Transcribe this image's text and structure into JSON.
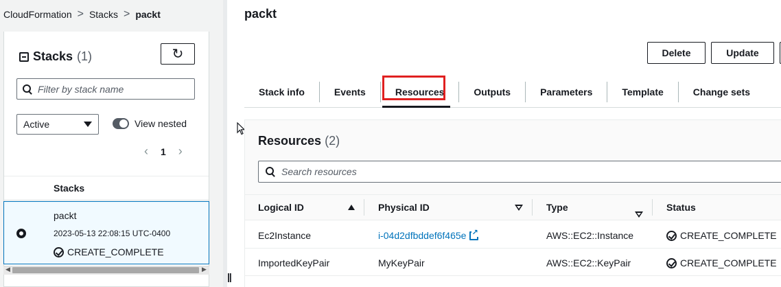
{
  "breadcrumb": {
    "items": [
      "CloudFormation",
      "Stacks"
    ],
    "current": "packt",
    "separator": ">"
  },
  "left": {
    "title": "Stacks",
    "count": "(1)",
    "refresh_icon": "↻",
    "filter_placeholder": "Filter by stack name",
    "status_filter": "Active",
    "view_nested_label": "View nested",
    "pager": {
      "prev": "‹",
      "page": "1",
      "next": "›"
    },
    "column_header": "Stacks",
    "stack": {
      "name": "packt",
      "timestamp": "2023-05-13 22:08:15 UTC-0400",
      "status": "CREATE_COMPLETE"
    }
  },
  "main": {
    "title": "packt",
    "buttons": {
      "delete": "Delete",
      "update": "Update"
    },
    "tabs": [
      "Stack info",
      "Events",
      "Resources",
      "Outputs",
      "Parameters",
      "Template",
      "Change sets"
    ],
    "active_tab": "Resources",
    "resources": {
      "title": "Resources",
      "count": "(2)",
      "search_placeholder": "Search resources",
      "columns": [
        "Logical ID",
        "Physical ID",
        "Type",
        "Status"
      ],
      "rows": [
        {
          "logical_id": "Ec2Instance",
          "physical_id": "i-04d2dfbddef6f465e",
          "type": "AWS::EC2::Instance",
          "status": "CREATE_COMPLETE"
        },
        {
          "logical_id": "ImportedKeyPair",
          "physical_id": "MyKeyPair",
          "type": "AWS::EC2::KeyPair",
          "status": "CREATE_COMPLETE"
        }
      ]
    }
  },
  "drag_handle": "||",
  "colors": {
    "link": "#0073bb",
    "highlight": "#e02020",
    "selected_row": "#f1faff"
  }
}
